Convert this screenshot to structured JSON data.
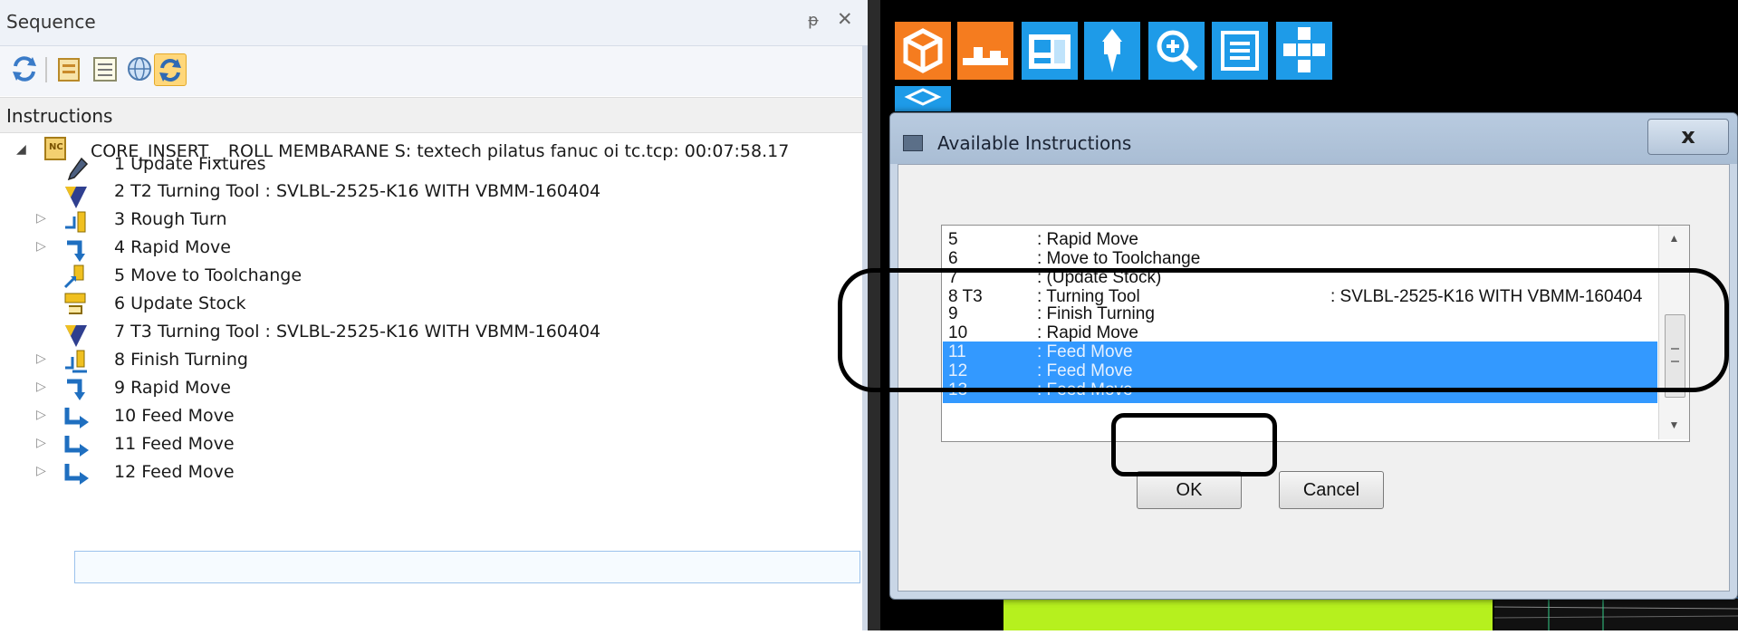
{
  "sequence_panel": {
    "title": "Sequence",
    "pin_glyph": "ᵽ",
    "close_glyph": "✕",
    "toolbar_icons": [
      "refresh-icon",
      "insert-icon",
      "list-icon",
      "globe-icon",
      "sync-icon"
    ],
    "instructions_header": "Instructions",
    "root": {
      "label": "CORE_INSERT _ ROLL MEMBARANE S: textech pilatus fanuc oi tc.tcp: 00:07:58.17",
      "icon": "nc-program-icon",
      "expander": "◢"
    },
    "items": [
      {
        "label": "1 Update Fixtures",
        "icon": "wrench-icon",
        "expandable": false
      },
      {
        "label": "2 T2 Turning Tool : SVLBL-2525-K16 WITH VBMM-160404",
        "icon": "turning-tool-icon",
        "expandable": false
      },
      {
        "label": "3 Rough Turn",
        "icon": "rough-turn-icon",
        "expandable": true
      },
      {
        "label": "4 Rapid Move",
        "icon": "rapid-move-icon",
        "expandable": true
      },
      {
        "label": "5 Move to Toolchange",
        "icon": "toolchange-icon",
        "expandable": false
      },
      {
        "label": "6 Update Stock",
        "icon": "update-stock-icon",
        "expandable": false
      },
      {
        "label": "7 T3 Turning Tool : SVLBL-2525-K16 WITH VBMM-160404",
        "icon": "turning-tool-icon",
        "expandable": false
      },
      {
        "label": "8 Finish Turning",
        "icon": "finish-turn-icon",
        "expandable": true
      },
      {
        "label": "9 Rapid Move",
        "icon": "rapid-move-icon",
        "expandable": true
      },
      {
        "label": "10 Feed Move",
        "icon": "feed-move-icon",
        "expandable": true
      },
      {
        "label": "11 Feed Move",
        "icon": "feed-move-icon",
        "expandable": true
      },
      {
        "label": "12 Feed Move",
        "icon": "feed-move-icon",
        "expandable": true
      }
    ],
    "expander_glyph": "▷"
  },
  "app_toolbar": {
    "icons": [
      "stock-box-icon",
      "fixture-icon",
      "machine-icon",
      "tool-icon",
      "zoom-icon",
      "list-view-icon",
      "layout-icon",
      "part-icon"
    ]
  },
  "dialog": {
    "title": "Available Instructions",
    "close_label": "x",
    "list": [
      {
        "num": "5",
        "desc": ": Rapid Move",
        "extra": "",
        "selected": false
      },
      {
        "num": "6",
        "desc": ": Move to Toolchange",
        "extra": "",
        "selected": false
      },
      {
        "num": "7",
        "desc": ": (Update Stock)",
        "extra": "",
        "selected": false
      },
      {
        "num": "8  T3",
        "desc": ": Turning Tool",
        "extra": ": SVLBL-2525-K16 WITH VBMM-160404",
        "selected": false
      },
      {
        "num": "9",
        "desc": ": Finish Turning",
        "extra": "",
        "selected": false
      },
      {
        "num": "10",
        "desc": ": Rapid Move",
        "extra": "",
        "selected": false
      },
      {
        "num": "11",
        "desc": ": Feed Move",
        "extra": "",
        "selected": true
      },
      {
        "num": "12",
        "desc": ": Feed Move",
        "extra": "",
        "selected": true
      },
      {
        "num": "13",
        "desc": ": Feed Move",
        "extra": "",
        "selected": true
      }
    ],
    "scroll_up": "▲",
    "scroll_down": "▼",
    "ok_label": "OK",
    "cancel_label": "Cancel"
  },
  "colors": {
    "selection": "#3399ff",
    "app_orange": "#f57c1f",
    "app_blue": "#1e9be8",
    "canvas_green": "#b6f01e"
  }
}
